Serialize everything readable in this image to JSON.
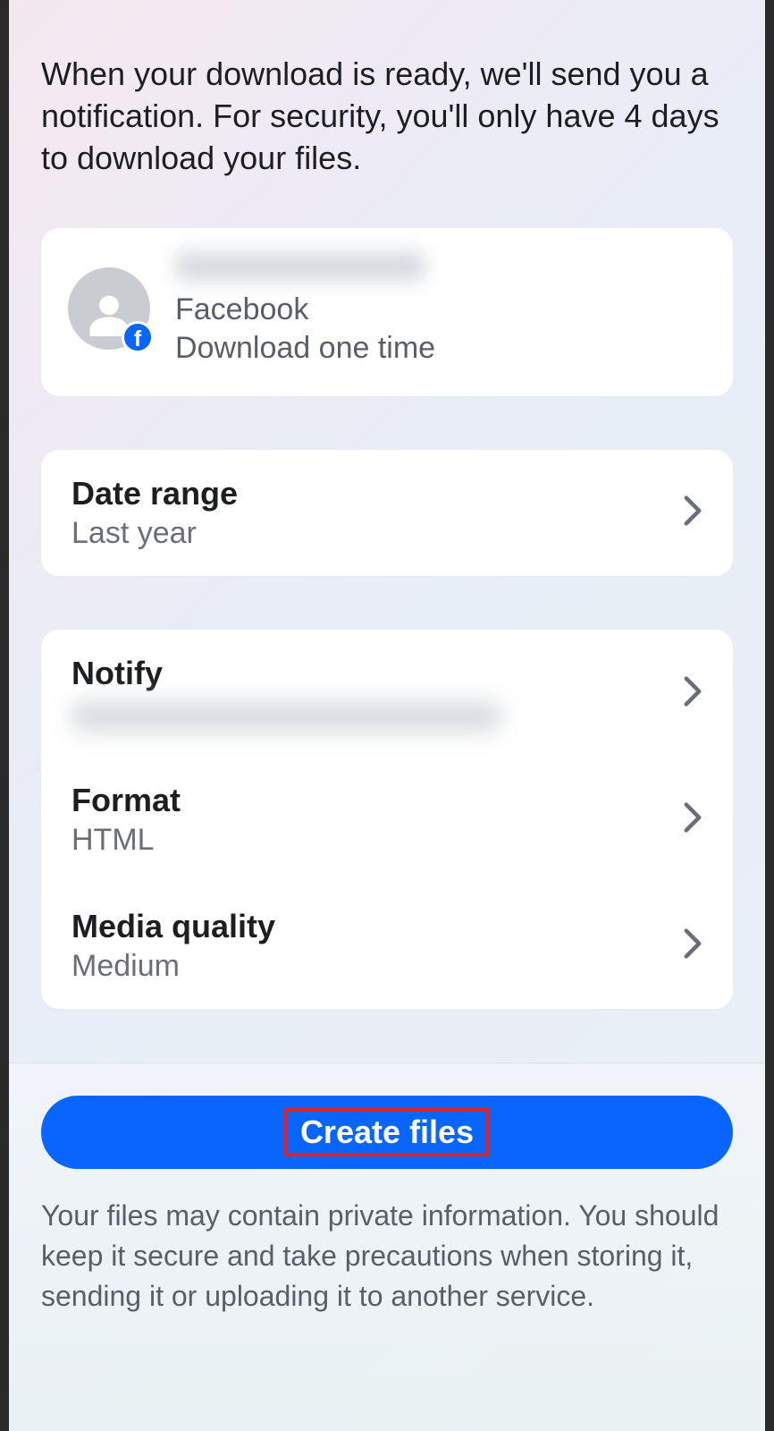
{
  "header": {
    "info_text": "When your download is ready, we'll send you a notification. For security, you'll only have 4 days to download your files."
  },
  "account": {
    "platform": "Facebook",
    "download_mode": "Download one time"
  },
  "date_range": {
    "title": "Date range",
    "value": "Last year"
  },
  "notify": {
    "title": "Notify"
  },
  "format": {
    "title": "Format",
    "value": "HTML"
  },
  "media_quality": {
    "title": "Media quality",
    "value": "Medium"
  },
  "actions": {
    "create_files_label": "Create files"
  },
  "footer": {
    "privacy_text": "Your files may contain private information. You should keep it secure and take precautions when storing it, sending it or uploading it to another service."
  }
}
